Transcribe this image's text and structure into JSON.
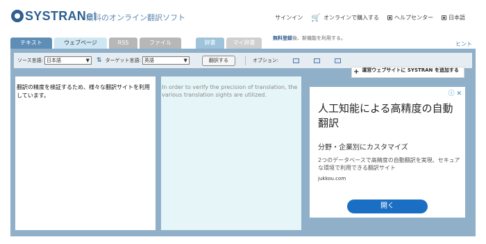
{
  "header": {
    "logo_main": "SYSTRAN",
    "logo_suffix": "et",
    "tagline": "無料のオンライン翻訳ソフト",
    "nav": {
      "signin": "サインイン",
      "buy": "オンラインで購入する",
      "help": "ヘルプセンター",
      "language": "日本語"
    }
  },
  "tabs": {
    "text": "テキスト",
    "webpage": "ウェブページ",
    "rss": "RSS",
    "file": "ファイル",
    "dictionary": "辞書",
    "my_dictionary": "マイ辞書"
  },
  "notice": {
    "bold": "無料登録",
    "rest": "後、新機能を利用する。"
  },
  "hint": "ヒント",
  "toolbar": {
    "source_label": "ソース言語:",
    "source_value": "日本語",
    "target_label": "ターゲット言語:",
    "target_value": "英語",
    "translate": "翻訳する",
    "options_label": "オプション:"
  },
  "add_site": "運営ウェブサイトに SYSTRAN を追加する",
  "source_text": "翻訳の精度を検証するため、様々な翻訳サイトを利用しています。",
  "target_text": "In order to verify the precision of translation, the various translation sights are utilized.",
  "ad": {
    "icons": "ⓘ ✕",
    "title": "人工知能による高精度の自動翻訳",
    "subtitle": "分野・企業別にカスタマイズ",
    "description": "2つのデータベースで高精度の自動翻訳を実現、セキュアな環境で利用できる翻訳サイト",
    "domain": "jukkou.com",
    "open": "開く"
  },
  "colors": {
    "panel": "#8fb0c8",
    "active_tab": "#5e8db6",
    "brand": "#2f5f8f",
    "ad_button": "#1a6fc4"
  }
}
